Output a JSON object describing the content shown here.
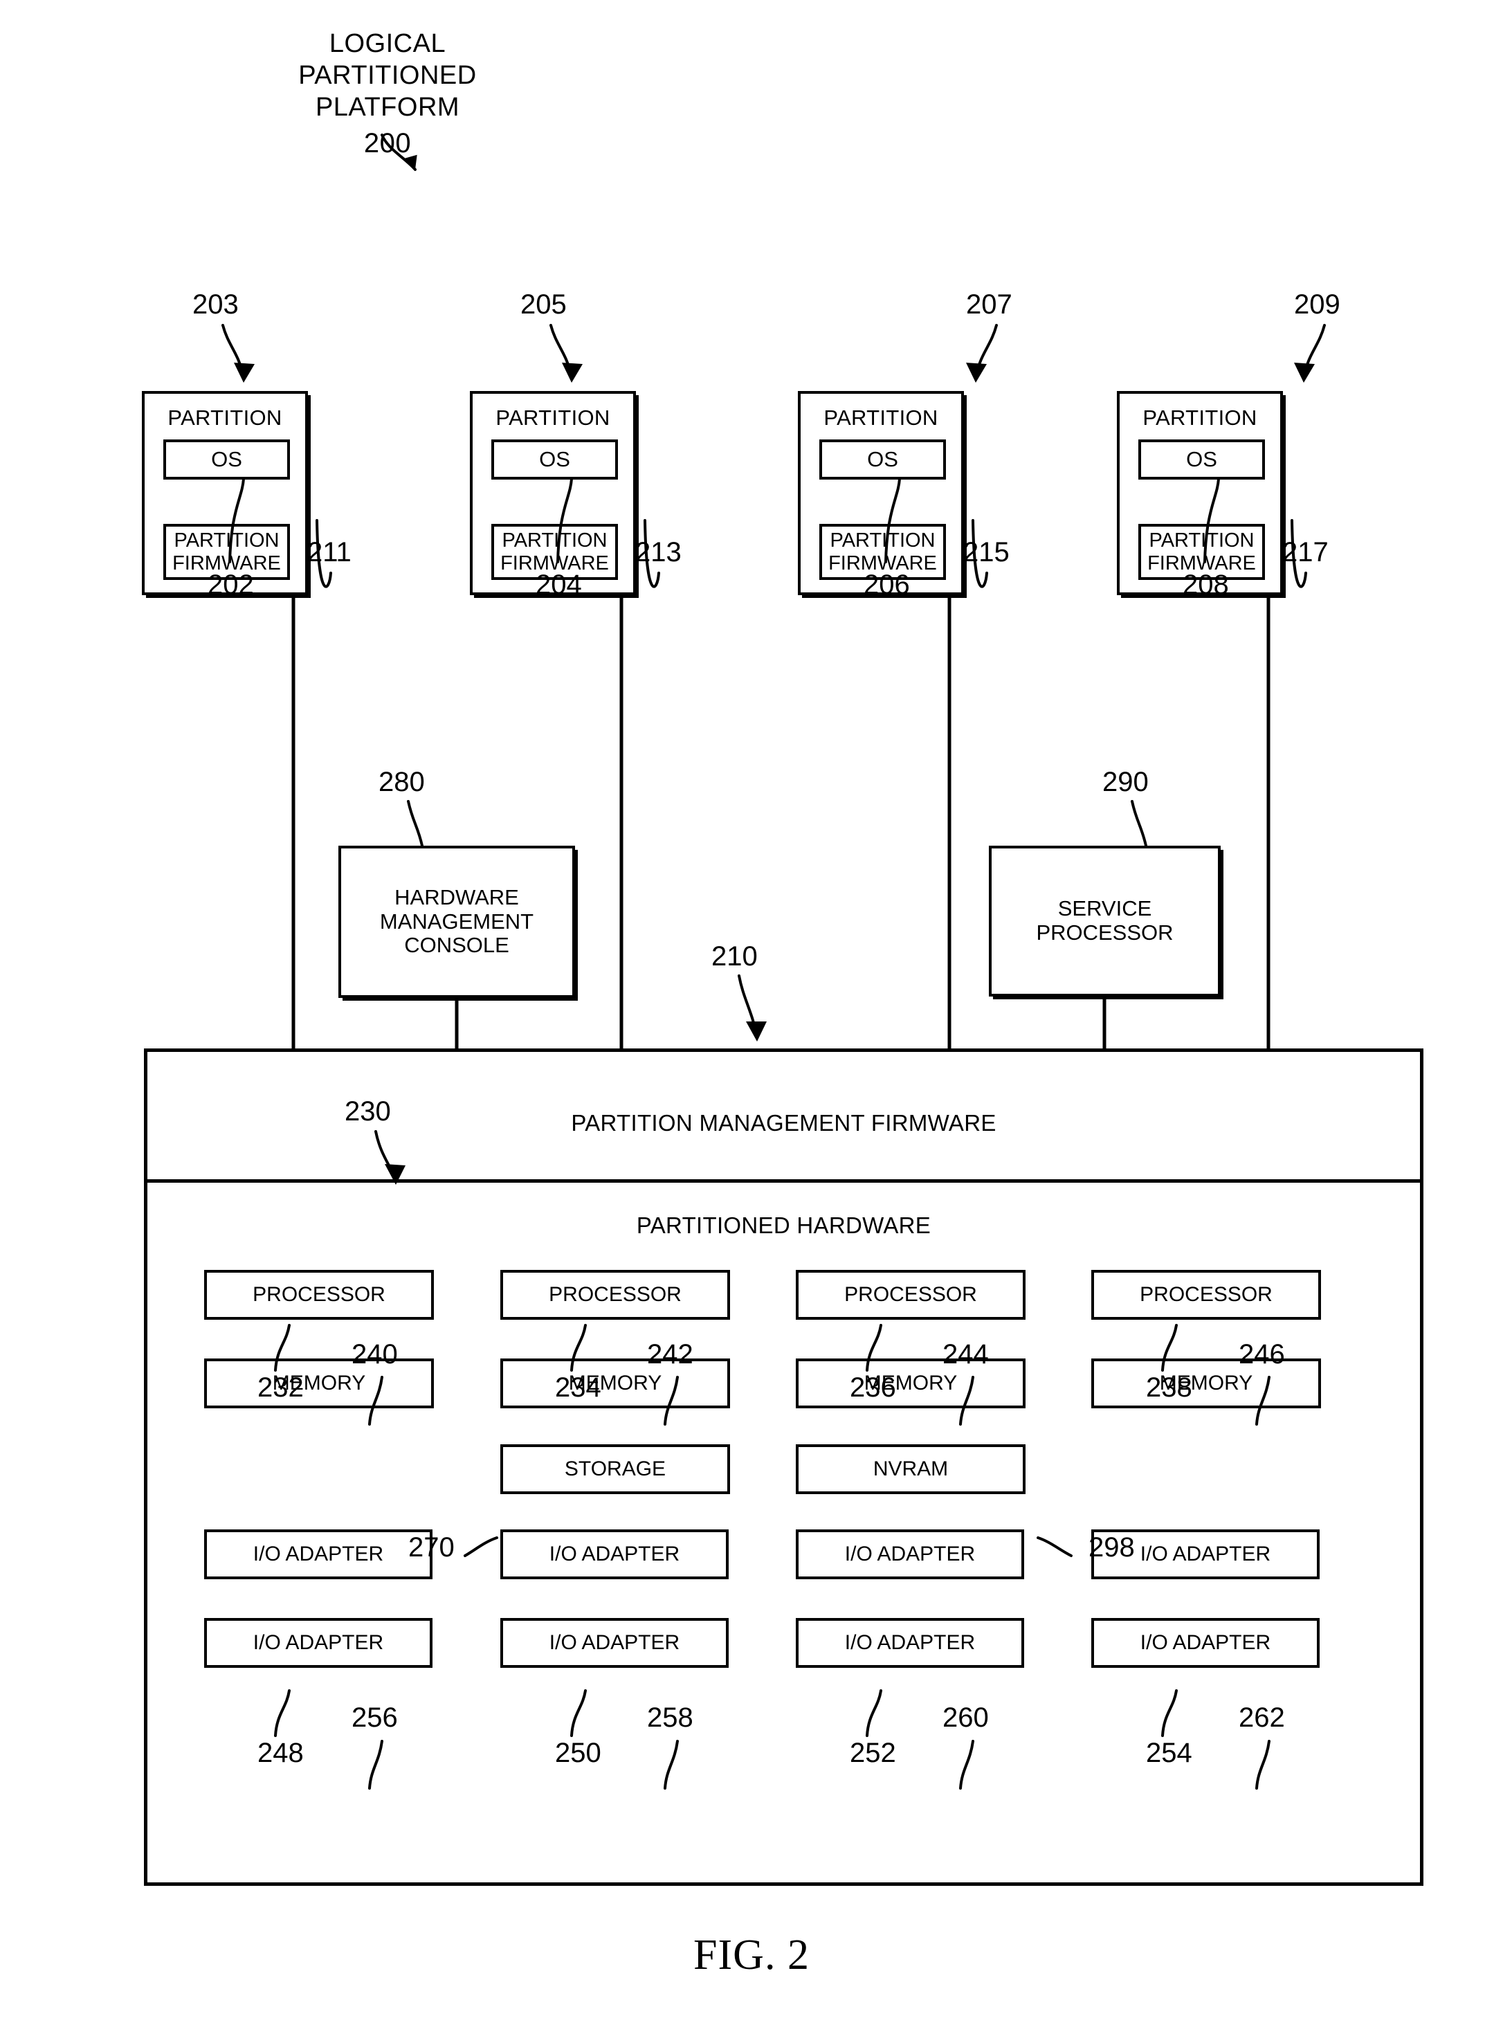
{
  "figure": {
    "caption": "FIG. 2",
    "title_lines": [
      "LOGICAL",
      "PARTITIONED",
      "PLATFORM"
    ],
    "title_ref": "200"
  },
  "partitions": [
    {
      "ref": "203",
      "title": "PARTITION",
      "os_label": "OS",
      "os_ref": "202",
      "firmware_label": "PARTITION FIRMWARE",
      "firmware_ref": "211"
    },
    {
      "ref": "205",
      "title": "PARTITION",
      "os_label": "OS",
      "os_ref": "204",
      "firmware_label": "PARTITION FIRMWARE",
      "firmware_ref": "213"
    },
    {
      "ref": "207",
      "title": "PARTITION",
      "os_label": "OS",
      "os_ref": "206",
      "firmware_label": "PARTITION FIRMWARE",
      "firmware_ref": "215"
    },
    {
      "ref": "209",
      "title": "PARTITION",
      "os_label": "OS",
      "os_ref": "208",
      "firmware_label": "PARTITION FIRMWARE",
      "firmware_ref": "217"
    }
  ],
  "middle": {
    "hmc": {
      "label": "HARDWARE MANAGEMENT CONSOLE",
      "ref": "280"
    },
    "service_processor": {
      "label": "SERVICE PROCESSOR",
      "ref": "290"
    },
    "platform_ref": "210"
  },
  "main": {
    "firmware_band": {
      "label": "PARTITION MANAGEMENT FIRMWARE",
      "ref": "230"
    },
    "hardware": {
      "label": "PARTITIONED HARDWARE",
      "processors": [
        {
          "label": "PROCESSOR",
          "ref": "232"
        },
        {
          "label": "PROCESSOR",
          "ref": "234"
        },
        {
          "label": "PROCESSOR",
          "ref": "236"
        },
        {
          "label": "PROCESSOR",
          "ref": "238"
        }
      ],
      "memories": [
        {
          "label": "MEMORY",
          "ref": "240"
        },
        {
          "label": "MEMORY",
          "ref": "242"
        },
        {
          "label": "MEMORY",
          "ref": "244"
        },
        {
          "label": "MEMORY",
          "ref": "246"
        }
      ],
      "storage": {
        "label": "STORAGE",
        "ref": "270"
      },
      "nvram": {
        "label": "NVRAM",
        "ref": "298"
      },
      "io_adapters_top": [
        {
          "label": "I/O ADAPTER",
          "ref": "248"
        },
        {
          "label": "I/O ADAPTER",
          "ref": "250"
        },
        {
          "label": "I/O ADAPTER",
          "ref": "252"
        },
        {
          "label": "I/O ADAPTER",
          "ref": "254"
        }
      ],
      "io_adapters_bottom": [
        {
          "label": "I/O ADAPTER",
          "ref": "256"
        },
        {
          "label": "I/O ADAPTER",
          "ref": "258"
        },
        {
          "label": "I/O ADAPTER",
          "ref": "260"
        },
        {
          "label": "I/O ADAPTER",
          "ref": "262"
        }
      ]
    }
  }
}
